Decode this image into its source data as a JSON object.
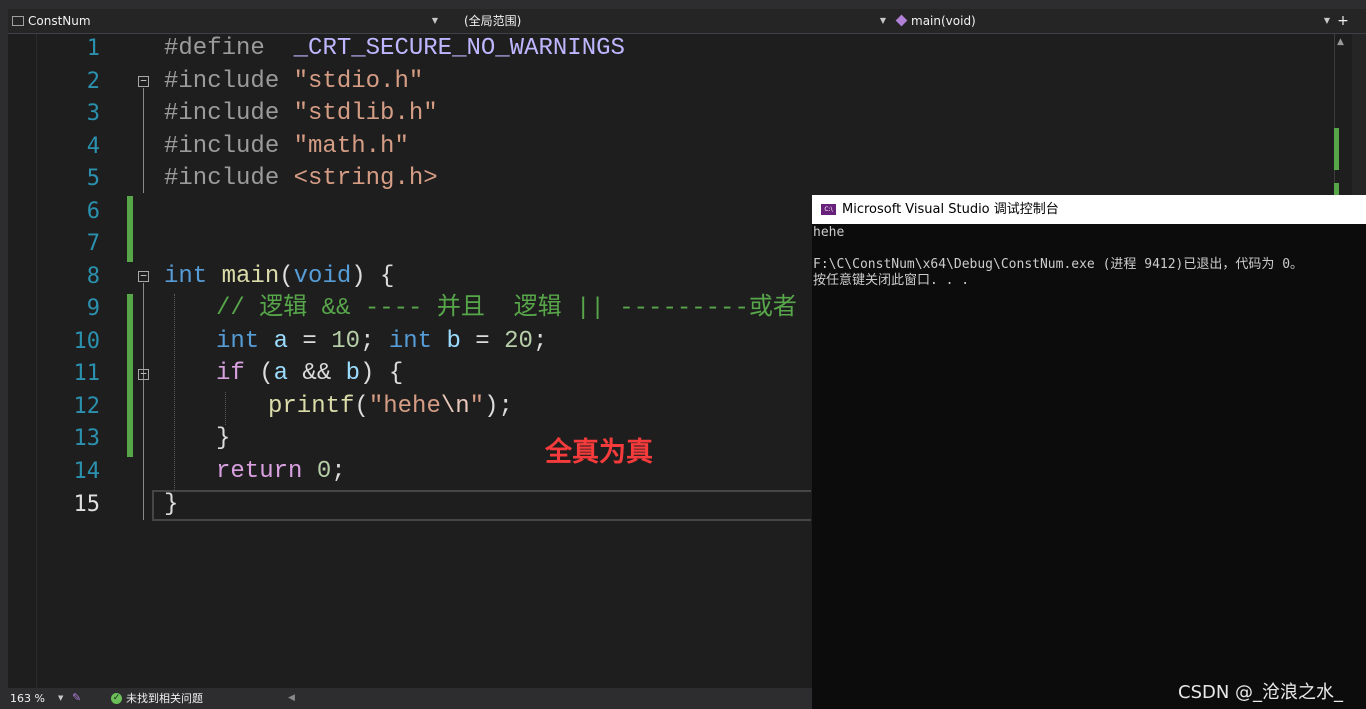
{
  "nav": {
    "project": "ConstNum",
    "scope": "(全局范围)",
    "function": "main(void)"
  },
  "editor": {
    "lines": [
      {
        "n": "1"
      },
      {
        "n": "2"
      },
      {
        "n": "3"
      },
      {
        "n": "4"
      },
      {
        "n": "5"
      },
      {
        "n": "6"
      },
      {
        "n": "7"
      },
      {
        "n": "8"
      },
      {
        "n": "9"
      },
      {
        "n": "10"
      },
      {
        "n": "11"
      },
      {
        "n": "12"
      },
      {
        "n": "13"
      },
      {
        "n": "14"
      },
      {
        "n": "15"
      }
    ],
    "code": {
      "l1_define": "#define",
      "l1_macro": "_CRT_SECURE_NO_WARNINGS",
      "include": "#include",
      "l2_str": "\"stdio.h\"",
      "l3_str": "\"stdlib.h\"",
      "l4_str": "\"math.h\"",
      "l5_str": "<string.h>",
      "kw_int": "int",
      "kw_void": "void",
      "fn_main": "main",
      "l9_comment": "// 逻辑 && ---- 并且  逻辑 || ---------或者",
      "var_a": "a",
      "var_b": "b",
      "num_10": "10",
      "num_20": "20",
      "num_0": "0",
      "kw_if": "if",
      "fn_printf": "printf",
      "l12_str1": "\"hehe",
      "l12_esc": "\\n",
      "l12_str2": "\"",
      "kw_return": "return"
    },
    "annotation": "全真为真"
  },
  "statusbar": {
    "zoom": "163 %",
    "issues": "未找到相关问题"
  },
  "console": {
    "title": "Microsoft Visual Studio 调试控制台",
    "icon_text": "C:\\",
    "line1": "hehe",
    "line2": "",
    "line3": "F:\\C\\ConstNum\\x64\\Debug\\ConstNum.exe (进程 9412)已退出，代码为 0。",
    "line4": "按任意键关闭此窗口. . ."
  },
  "watermark": "CSDN @_沧浪之水_",
  "colors": {
    "keyword": "#569cd6",
    "string": "#d69d85",
    "comment": "#57a64a",
    "number": "#b5cea8",
    "annotation": "#f53b3b",
    "change_bar": "#57a64a"
  }
}
